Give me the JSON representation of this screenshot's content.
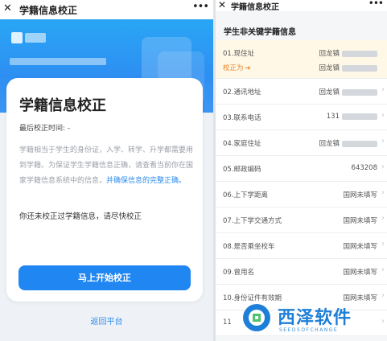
{
  "left": {
    "header": {
      "close_icon": "close-icon",
      "title": "学籍信息校正",
      "more_icon": "more-icon"
    },
    "card": {
      "heading": "学籍信息校正",
      "last_check_label": "最后校正时间: -",
      "description_pre": "学籍相当于学生的身份证，入学、转学、升学都需要用到学籍。为保证学生学籍信息正确，请查看当前你在国家学籍信息系统中的信息，",
      "description_link": "并确保信息的完整正确。",
      "notice": "你还未校正过学籍信息，请尽快校正",
      "start_button": "马上开始校正"
    },
    "return_link": "返回平台"
  },
  "right": {
    "header": {
      "close_icon": "close-icon",
      "title": "学籍信息校正",
      "more_icon": "more-icon"
    },
    "section_title": "学生非关键学籍信息",
    "rows": [
      {
        "label": "01.现住址",
        "value": "回龙镇",
        "correction_label": "校正为",
        "correction_value": "回龙镇"
      },
      {
        "label": "02.通讯地址",
        "value": "回龙镇"
      },
      {
        "label": "03.联系电话",
        "value": "131"
      },
      {
        "label": "04.家庭住址",
        "value": "回龙镇"
      },
      {
        "label": "05.邮政编码",
        "value": "643208"
      },
      {
        "label": "06.上下学距离",
        "value": "国网未填写"
      },
      {
        "label": "07.上下学交通方式",
        "value": "国网未填写"
      },
      {
        "label": "08.是否乘坐校车",
        "value": "国网未填写"
      },
      {
        "label": "09.曾用名",
        "value": "国网未填写"
      },
      {
        "label": "10.身份证件有效期",
        "value": "国网未填写"
      },
      {
        "label": "11",
        "value": ""
      }
    ]
  },
  "watermark": {
    "brand": "西泽软件",
    "sub": "SEEDSOFCHANGE"
  },
  "colors": {
    "accent": "#1f86f2",
    "warning": "#e8842a",
    "highlight_bg": "#fff8e6"
  }
}
